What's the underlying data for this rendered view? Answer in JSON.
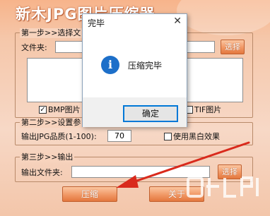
{
  "app": {
    "title": "新木JPG图片压缩器",
    "step1": {
      "legend": "第一步>>选择文",
      "folder_label": "文件夹:",
      "browse_button": "选择",
      "bmp_label": "BMP图片",
      "tif_label": "TIF图片"
    },
    "step2": {
      "legend": "第二步>>设置参",
      "quality_label": "输出JPG品质(1-100):",
      "quality_value": "70",
      "bw_label": "使用黑白效果"
    },
    "step3": {
      "legend": "第三步>>输出",
      "output_label": "输出文件夹:",
      "browse_button": "选择"
    },
    "compress_button": "压缩",
    "about_button": "关于"
  },
  "dialog": {
    "title": "完毕",
    "close_symbol": "✕",
    "message": "压缩完毕",
    "ok_button": "确定",
    "icon": "info-icon"
  },
  "colors": {
    "accent": "#e3773e",
    "arrow": "#d92a1c",
    "dialog_button_border": "#0078d7"
  }
}
